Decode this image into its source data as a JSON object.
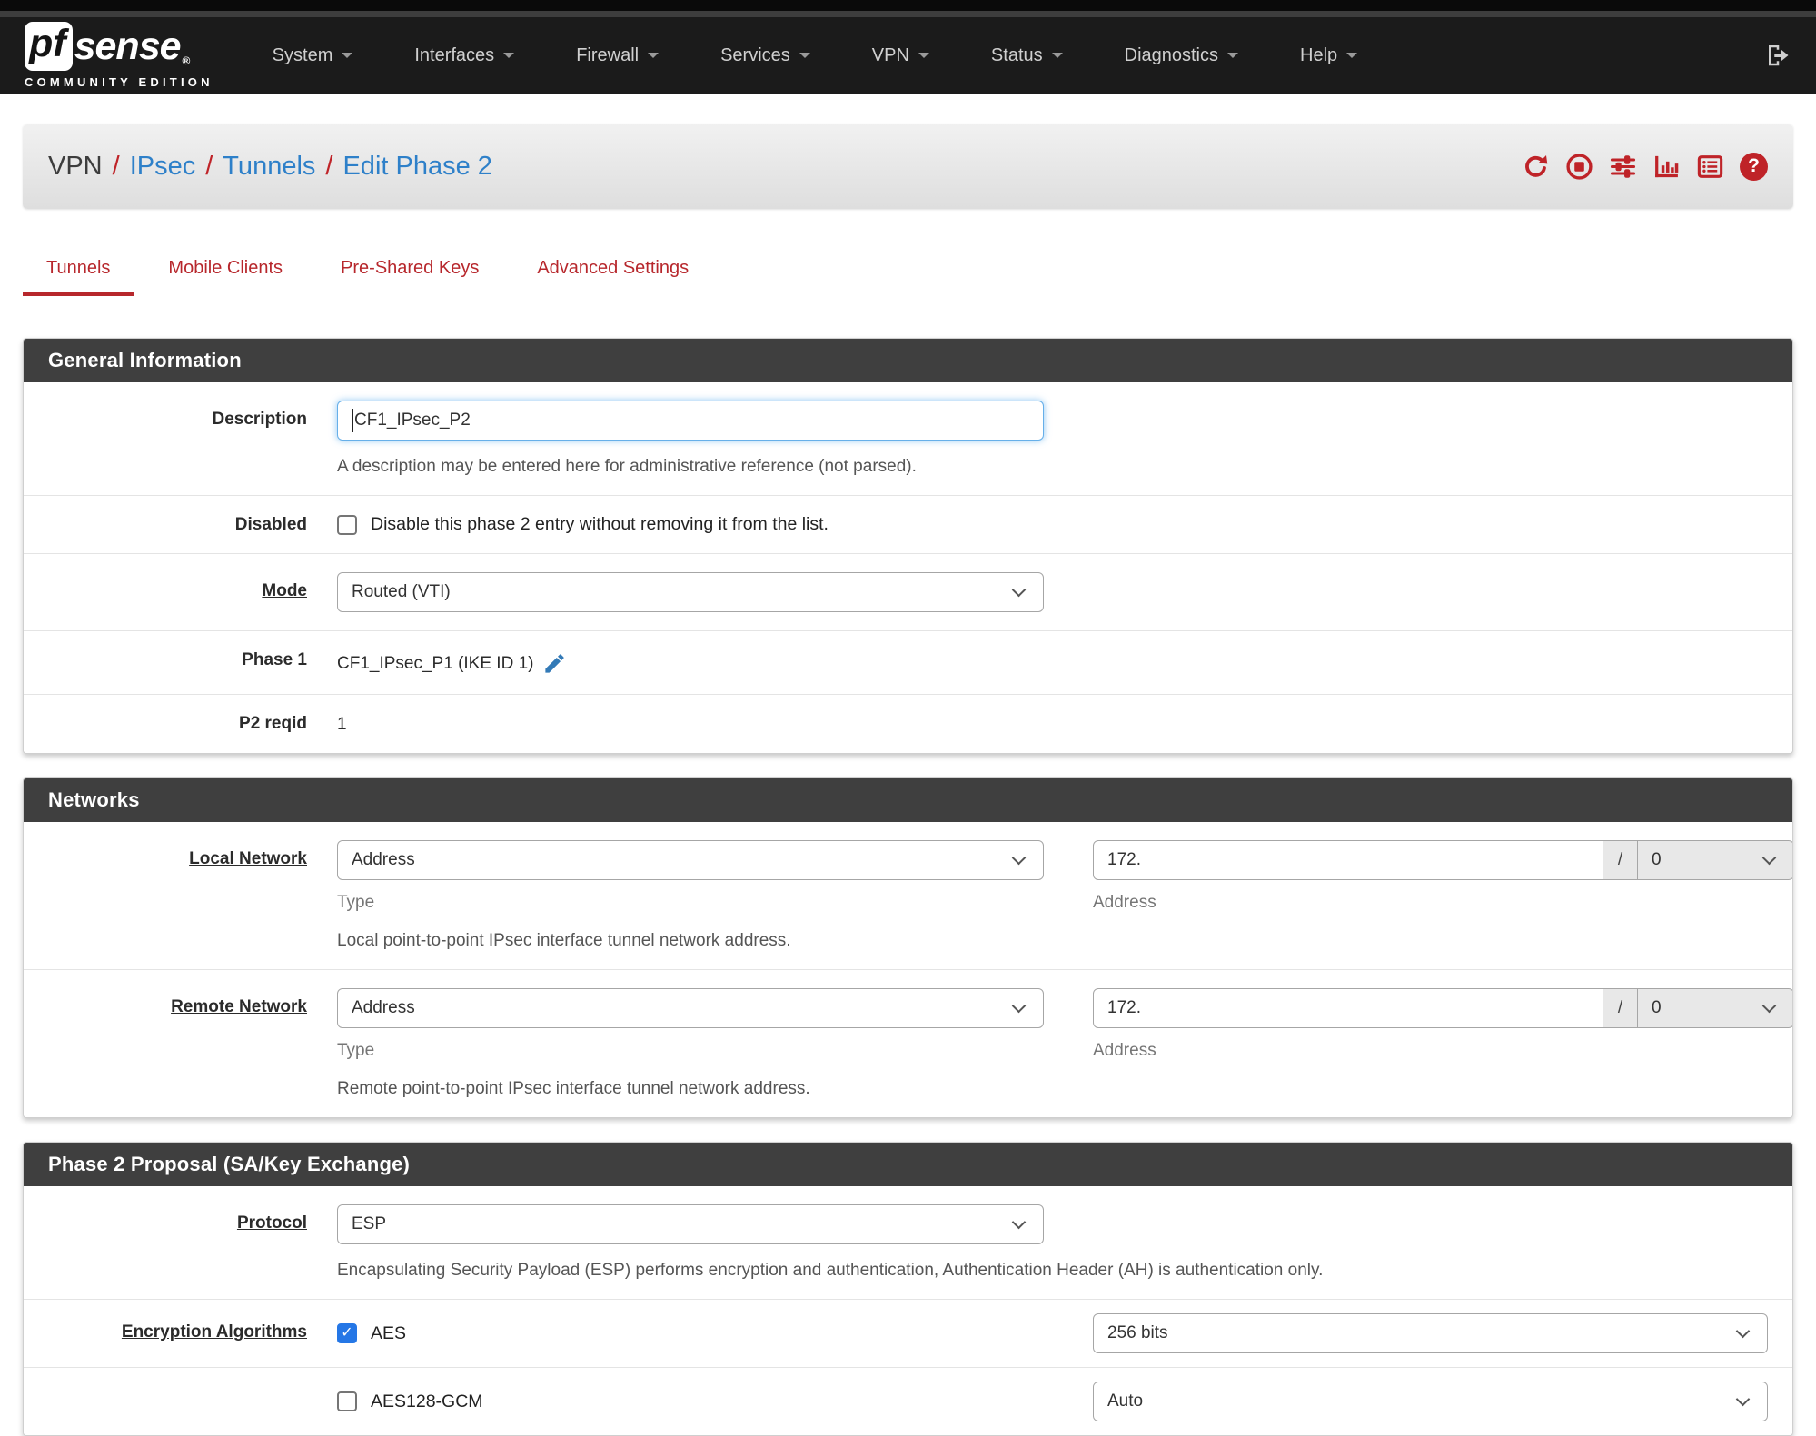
{
  "colors": {
    "brand_red": "#bf2328",
    "tab_red": "#b7272c",
    "link_blue": "#2e80c9",
    "navbar_bg": "#1b1b1b",
    "section_header_bg": "#3f3f3f",
    "checkbox_blue": "#2577e6"
  },
  "navbar": {
    "logo": {
      "pf": "pf",
      "sense": "sense",
      "registered": "®",
      "edition": "COMMUNITY EDITION"
    },
    "items": [
      {
        "label": "System"
      },
      {
        "label": "Interfaces"
      },
      {
        "label": "Firewall"
      },
      {
        "label": "Services"
      },
      {
        "label": "VPN"
      },
      {
        "label": "Status"
      },
      {
        "label": "Diagnostics"
      },
      {
        "label": "Help"
      }
    ]
  },
  "breadcrumb": {
    "section": "VPN",
    "separator": "/",
    "crumbs": [
      "IPsec",
      "Tunnels",
      "Edit Phase 2"
    ]
  },
  "header_icons": [
    "refresh-icon",
    "stop-circle-icon",
    "sliders-icon",
    "bar-chart-icon",
    "list-icon",
    "help-icon"
  ],
  "help_icon_glyph": "?",
  "tabs": [
    {
      "label": "Tunnels",
      "active": true
    },
    {
      "label": "Mobile Clients",
      "active": false
    },
    {
      "label": "Pre-Shared Keys",
      "active": false
    },
    {
      "label": "Advanced Settings",
      "active": false
    }
  ],
  "general": {
    "title": "General Information",
    "description": {
      "label": "Description",
      "value": "CF1_IPsec_P2",
      "help": "A description may be entered here for administrative reference (not parsed)."
    },
    "disabled": {
      "label": "Disabled",
      "checkbox_label": "Disable this phase 2 entry without removing it from the list.",
      "checked": false
    },
    "mode": {
      "label": "Mode",
      "value": "Routed (VTI)"
    },
    "phase1": {
      "label": "Phase 1",
      "value": "CF1_IPsec_P1 (IKE ID 1)"
    },
    "p2reqid": {
      "label": "P2 reqid",
      "value": "1"
    }
  },
  "networks": {
    "title": "Networks",
    "local": {
      "label": "Local Network",
      "type_value": "Address",
      "type_caption": "Type",
      "address_value": "172.",
      "address_caption": "Address",
      "separator": "/",
      "prefix_value": "0",
      "help": "Local point-to-point IPsec interface tunnel network address."
    },
    "remote": {
      "label": "Remote Network",
      "type_value": "Address",
      "type_caption": "Type",
      "address_value": "172.",
      "address_caption": "Address",
      "separator": "/",
      "prefix_value": "0",
      "help": "Remote point-to-point IPsec interface tunnel network address."
    }
  },
  "proposal": {
    "title": "Phase 2 Proposal (SA/Key Exchange)",
    "protocol": {
      "label": "Protocol",
      "value": "ESP",
      "help": "Encapsulating Security Payload (ESP) performs encryption and authentication, Authentication Header (AH) is authentication only."
    },
    "encryption": {
      "label": "Encryption Algorithms",
      "algorithms": [
        {
          "name": "AES",
          "checked": true,
          "keylen": "256 bits"
        },
        {
          "name": "AES128-GCM",
          "checked": false,
          "keylen": "Auto"
        }
      ]
    }
  }
}
